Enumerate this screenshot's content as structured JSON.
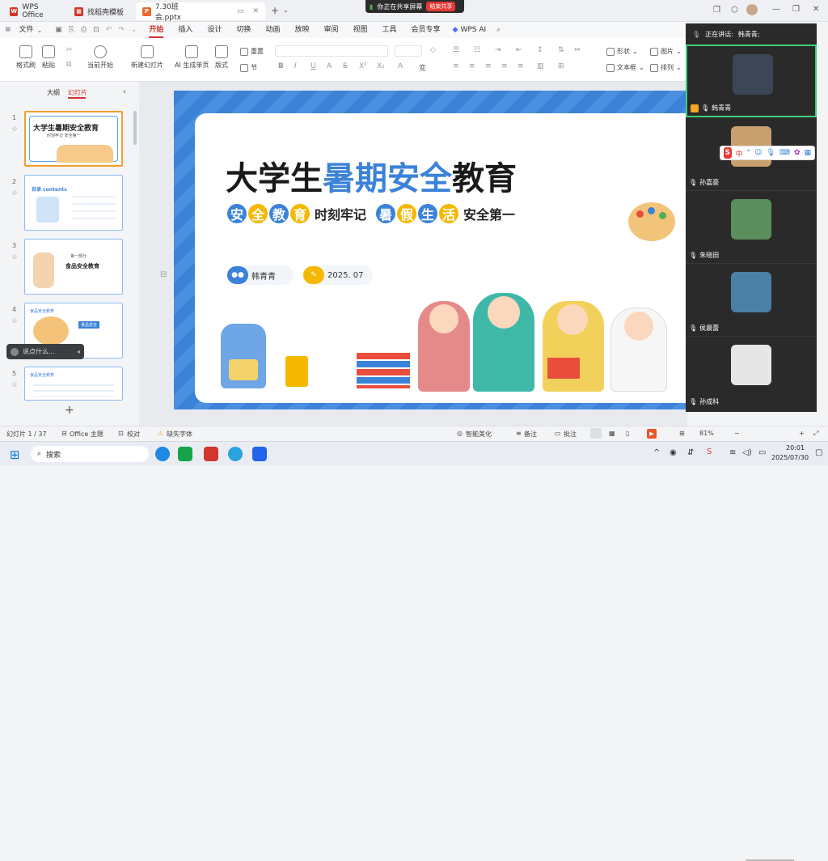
{
  "tabs": [
    {
      "icon": "wps-logo-icon",
      "label": "WPS Office"
    },
    {
      "icon": "template-icon",
      "label": "找稻壳模板"
    },
    {
      "icon": "ppt-file-icon",
      "label": "7.30班会.pptx"
    }
  ],
  "share_banner": {
    "text": "你正在共享屏幕",
    "stop": "结束共享"
  },
  "menu": {
    "file": "文件",
    "items": [
      "开始",
      "插入",
      "设计",
      "切换",
      "动画",
      "放映",
      "审阅",
      "视图",
      "工具",
      "会员专享"
    ],
    "ai": "WPS AI"
  },
  "ribbon": {
    "format_painter": "格式刷",
    "paste": "粘贴",
    "from_current": "当前开始",
    "new_slide": "新建幻灯片",
    "ai_slide": "AI 生成单页",
    "layout": "版式",
    "reset": "重置",
    "section": "节",
    "shape": "形状",
    "picture": "图片",
    "textbox": "文本框",
    "arrange": "排列"
  },
  "left_pane": {
    "outline": "大纲",
    "slides": "幻灯片",
    "add": "+"
  },
  "thumbnails": [
    {
      "num": "1",
      "title": "大学生暑期安全教育",
      "sub": "时刻牢记 安全第一"
    },
    {
      "num": "2",
      "title": "目录 contents",
      "sub": "暑期安全教育"
    },
    {
      "num": "3",
      "title": "食品安全教育",
      "sub": "第一部分"
    },
    {
      "num": "4",
      "title": "食品安全教育",
      "sub": "食品安全"
    },
    {
      "num": "5",
      "title": "食品安全教育",
      "sub": ""
    }
  ],
  "chat_bubble": "说点什么...",
  "slide": {
    "title_a": "大学生",
    "title_b": "暑期安全",
    "title_c": "教育",
    "sub_chars_1": [
      "安",
      "全",
      "教",
      "育"
    ],
    "sub_text_1": "时刻牢记",
    "sub_chars_2": [
      "暑",
      "假",
      "生",
      "活"
    ],
    "sub_text_2": "安全第一",
    "author": "韩青青",
    "date": "2025. 07"
  },
  "meeting": {
    "speaking_label": "正在讲话:",
    "speaking_name": "韩青青;",
    "participants": [
      "韩青青",
      "孙嘉豪",
      "朱晓田",
      "侯晨蕾",
      "孙成科"
    ]
  },
  "ime_bar": {
    "label": "中"
  },
  "status": {
    "slide_pos": "幻灯片 1 / 37",
    "theme": "Office 主题",
    "proof": "校对",
    "missing_font": "缺失字体",
    "beautify": "智能美化",
    "notes": "备注",
    "comment": "批注",
    "zoom": "81%"
  },
  "taskbar": {
    "search": "搜索",
    "time": "20:01",
    "date": "2025/07/30"
  },
  "colors": {
    "accent": "#d0362c",
    "slide_blue": "#3b82d9",
    "yellow": "#f5b800"
  }
}
